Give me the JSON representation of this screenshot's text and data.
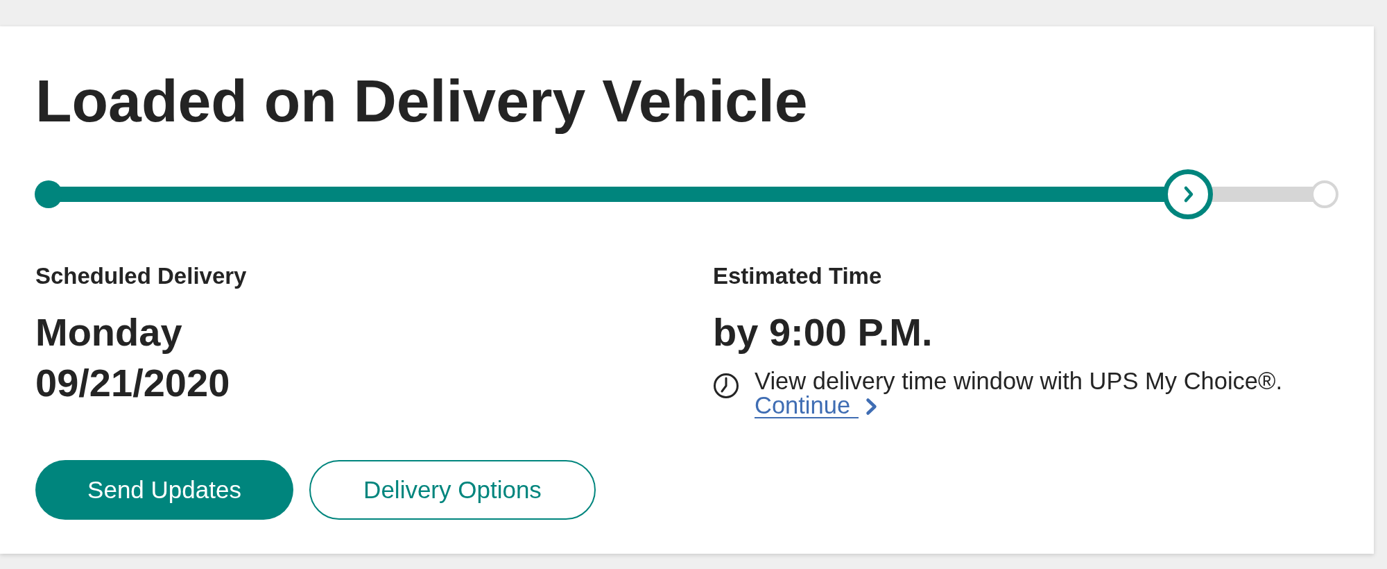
{
  "status": {
    "title": "Loaded on Delivery Vehicle"
  },
  "progress": {
    "level": 0.9
  },
  "scheduled_delivery": {
    "label": "Scheduled Delivery",
    "day": "Monday",
    "date": "09/21/2020"
  },
  "estimated_time": {
    "label": "Estimated Time",
    "value": "by 9:00 P.M.",
    "note": "View delivery time window with UPS My Choice®.",
    "link": "Continue"
  },
  "buttons": [
    {
      "label": "Send Updates",
      "kind": "primary"
    },
    {
      "label": "Delivery Options",
      "kind": "secondary"
    }
  ]
}
